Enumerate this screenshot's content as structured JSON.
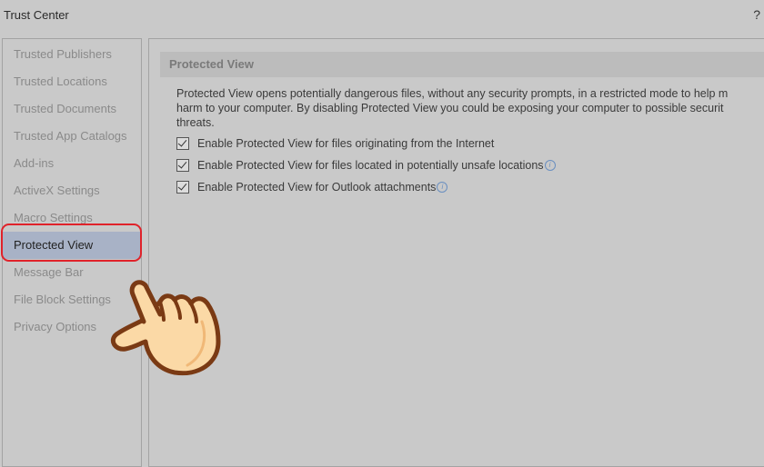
{
  "window": {
    "title": "Trust Center",
    "help": "?"
  },
  "sidebar": {
    "items": [
      {
        "label": "Trusted Publishers"
      },
      {
        "label": "Trusted Locations"
      },
      {
        "label": "Trusted Documents"
      },
      {
        "label": "Trusted App Catalogs"
      },
      {
        "label": "Add-ins"
      },
      {
        "label": "ActiveX Settings"
      },
      {
        "label": "Macro Settings"
      },
      {
        "label": "Protected View"
      },
      {
        "label": "Message Bar"
      },
      {
        "label": "File Block Settings"
      },
      {
        "label": "Privacy Options"
      }
    ],
    "active_index": 7
  },
  "main": {
    "header": "Protected View",
    "description": "Protected View opens potentially dangerous files, without any security prompts, in a restricted mode to help m\nharm to your computer. By disabling Protected View you could be exposing your computer to possible securit\nthreats.",
    "options": [
      {
        "label": "Enable Protected View for files originating from the Internet",
        "checked": true,
        "info": false
      },
      {
        "label": "Enable Protected View for files located in potentially unsafe locations",
        "checked": true,
        "info": true
      },
      {
        "label": "Enable Protected View for Outlook attachments",
        "checked": true,
        "info": true
      }
    ]
  },
  "colors": {
    "background": "#c9c9c9",
    "active_item": "#a8b2c6",
    "highlight_ring": "#e0222a",
    "hand_fill": "#fbd9a6",
    "hand_outline": "#7a3a14"
  },
  "icons": {
    "info": "info-circle-icon",
    "pointer": "pointing-hand-icon"
  }
}
